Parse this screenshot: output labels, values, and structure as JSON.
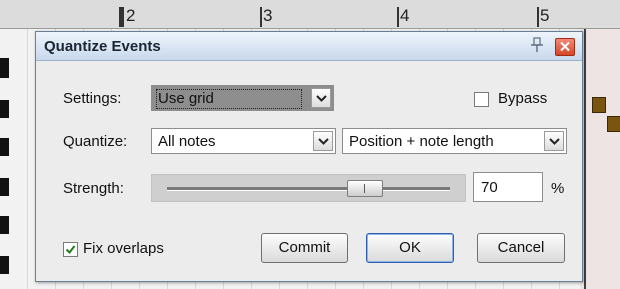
{
  "ruler": {
    "marks": [
      "2",
      "3",
      "4",
      "5"
    ]
  },
  "dialog": {
    "title": "Quantize Events",
    "settings": {
      "label": "Settings:",
      "value": "Use grid"
    },
    "bypass": {
      "label": "Bypass",
      "checked": false
    },
    "quantize": {
      "label": "Quantize:",
      "notes_value": "All notes",
      "mode_value": "Position + note length"
    },
    "strength": {
      "label": "Strength:",
      "value": "70",
      "unit": "%",
      "level": 0.7
    },
    "fix_overlaps": {
      "label": "Fix overlaps",
      "checked": true
    },
    "buttons": {
      "commit": "Commit",
      "ok": "OK",
      "cancel": "Cancel"
    }
  }
}
